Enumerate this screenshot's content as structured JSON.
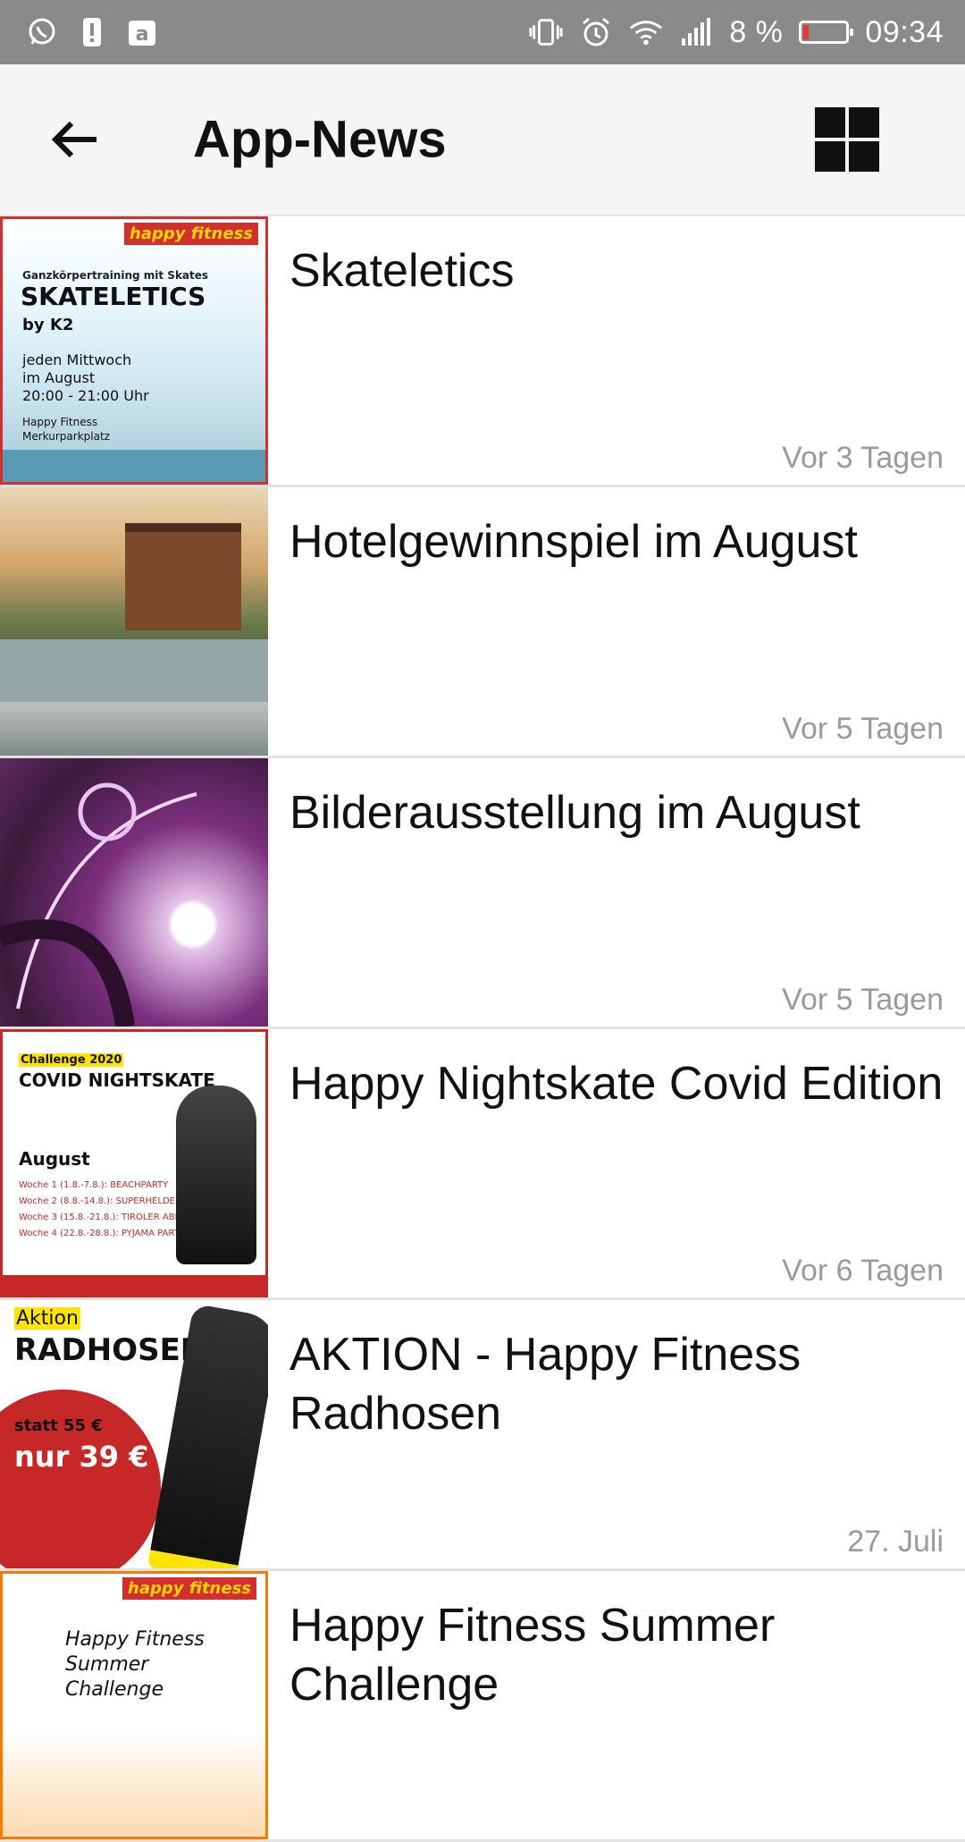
{
  "status_bar": {
    "battery_percent": "8 %",
    "time": "09:34"
  },
  "app_bar": {
    "title": "App-News"
  },
  "news": [
    {
      "title": "Skateletics",
      "date": "Vor 3 Tagen",
      "thumb": {
        "brand": "happy fitness",
        "line1": "Ganzkörpertraining mit Skates",
        "headline": "SKATELETICS",
        "byline": "by K2",
        "info1": "jeden Mittwoch",
        "info2": "im August",
        "info3": "20:00 - 21:00 Uhr",
        "info4": "Happy Fitness",
        "info5": "Merkurparkplatz"
      }
    },
    {
      "title": "Hotelgewinnspiel  im August",
      "date": "Vor 5 Tagen"
    },
    {
      "title": "Bilderausstellung im August",
      "date": "Vor 5 Tagen"
    },
    {
      "title": "Happy Nightskate Covid Edition",
      "date": "Vor 6 Tagen",
      "thumb": {
        "tag": "Challenge 2020",
        "headline": "COVID NIGHTSKATE",
        "month": "August",
        "week1": "Woche 1 (1.8.-7.8.): BEACHPARTY",
        "week2": "Woche 2 (8.8.-14.8.): SUPERHELDEN",
        "week3": "Woche 3 (15.8.-21.8.): TIROLER ABEND",
        "week4": "Woche 4 (22.8.-28.8.): PYJAMA PARTY"
      }
    },
    {
      "title": "AKTION - Happy Fitness Radhosen",
      "date": "27. Juli",
      "thumb": {
        "tag": "Aktion",
        "headline": "RADHOSEN",
        "old_price": "statt 55 €",
        "new_price": "nur 39 €"
      }
    },
    {
      "title": "Happy Fitness Summer Challenge",
      "date": "",
      "thumb": {
        "brand": "happy fitness",
        "script": "Happy Fitness Summer Challenge"
      }
    }
  ],
  "colors": {
    "status_bar_bg": "#8a8a8a",
    "app_bar_bg": "#f5f5f5",
    "date_text": "#9a9a9a",
    "brand_red": "#d32f2f"
  }
}
